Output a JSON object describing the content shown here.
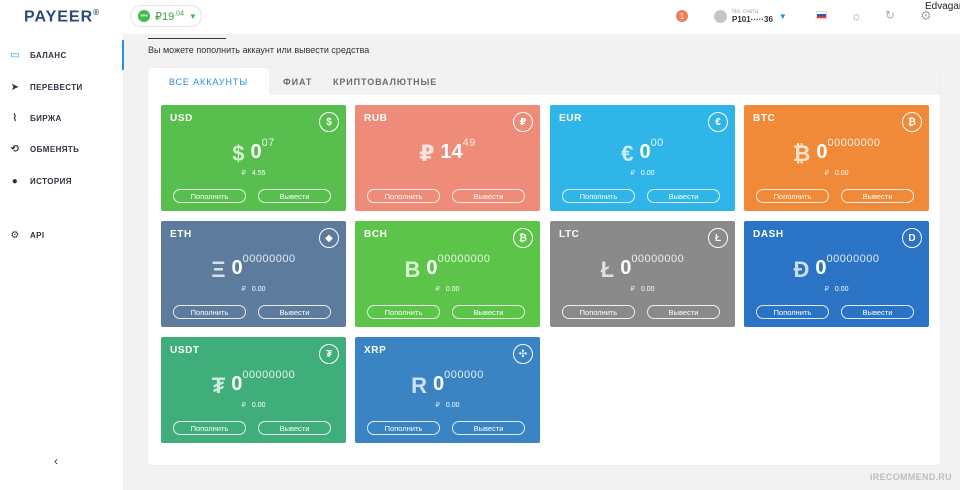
{
  "header": {
    "logo": "PAYEER",
    "logo_mark": "®",
    "balance_icon": "•••",
    "balance_int": "₽19",
    "balance_dec": ".04",
    "notification_count": "1",
    "account_label": "No. счета",
    "account_number": "P101·····36",
    "username": "Edvagan"
  },
  "sidebar": {
    "items": [
      {
        "label": "БАЛАНС",
        "icon": "wallet-icon"
      },
      {
        "label": "ПЕРЕВЕСТИ",
        "icon": "send-icon"
      },
      {
        "label": "БИРЖА",
        "icon": "chart-icon"
      },
      {
        "label": "ОБМЕНЯТЬ",
        "icon": "exchange-icon"
      },
      {
        "label": "ИСТОРИЯ",
        "icon": "clock-icon"
      },
      {
        "label": "API",
        "icon": "gears-icon"
      }
    ]
  },
  "main": {
    "subtitle": "Вы можете пополнить аккаунт или вывести средства",
    "tabs": [
      {
        "label": "ВСЕ АККАУНТЫ"
      },
      {
        "label": "ФИАТ"
      },
      {
        "label": "КРИПТОВАЛЮТНЫЕ"
      }
    ]
  },
  "cards": [
    {
      "code": "USD",
      "badge": "$",
      "sym": "$",
      "int": "0",
      "dec": "07",
      "rub_sym": "₽",
      "rub": "4.55",
      "dep": "Пополнить",
      "wd": "Вывести",
      "color": "#58bf4f"
    },
    {
      "code": "RUB",
      "badge": "₽",
      "sym": "₽",
      "int": "14",
      "dec": "49",
      "rub_sym": "",
      "rub": "",
      "dep": "Пополнить",
      "wd": "Вывести",
      "color": "#ee8b79"
    },
    {
      "code": "EUR",
      "badge": "€",
      "sym": "€",
      "int": "0",
      "dec": "00",
      "rub_sym": "₽",
      "rub": "0.00",
      "dep": "Пополнить",
      "wd": "Вывести",
      "color": "#30b5e9"
    },
    {
      "code": "BTC",
      "badge": "₿",
      "sym": "₿",
      "int": "0",
      "dec": "00000000",
      "rub_sym": "₽",
      "rub": "0.00",
      "dep": "Пополнить",
      "wd": "Вывести",
      "color": "#f08a38"
    },
    {
      "code": "ETH",
      "badge": "◆",
      "sym": "Ξ",
      "int": "0",
      "dec": "00000000",
      "rub_sym": "₽",
      "rub": "0.00",
      "dep": "Пополнить",
      "wd": "Вывести",
      "color": "#5d7b9c"
    },
    {
      "code": "BCH",
      "badge": "₿",
      "sym": "B",
      "int": "0",
      "dec": "00000000",
      "rub_sym": "₽",
      "rub": "0.00",
      "dep": "Пополнить",
      "wd": "Вывести",
      "color": "#5cc449"
    },
    {
      "code": "LTC",
      "badge": "Ł",
      "sym": "Ł",
      "int": "0",
      "dec": "00000000",
      "rub_sym": "₽",
      "rub": "0.00",
      "dep": "Пополнить",
      "wd": "Вывести",
      "color": "#8a8a8a"
    },
    {
      "code": "DASH",
      "badge": "D",
      "sym": "Đ",
      "int": "0",
      "dec": "00000000",
      "rub_sym": "₽",
      "rub": "0.00",
      "dep": "Пополнить",
      "wd": "Вывести",
      "color": "#2b73c4"
    },
    {
      "code": "USDT",
      "badge": "₮",
      "sym": "₮",
      "int": "0",
      "dec": "00000000",
      "rub_sym": "₽",
      "rub": "0.00",
      "dep": "Пополнить",
      "wd": "Вывести",
      "color": "#3fae7b"
    },
    {
      "code": "XRP",
      "badge": "✣",
      "sym": "R",
      "int": "0",
      "dec": "000000",
      "rub_sym": "₽",
      "rub": "0.00",
      "dep": "Пополнить",
      "wd": "Вывести",
      "color": "#3a84c4"
    }
  ],
  "watermark": "iRECOMMEND.RU"
}
